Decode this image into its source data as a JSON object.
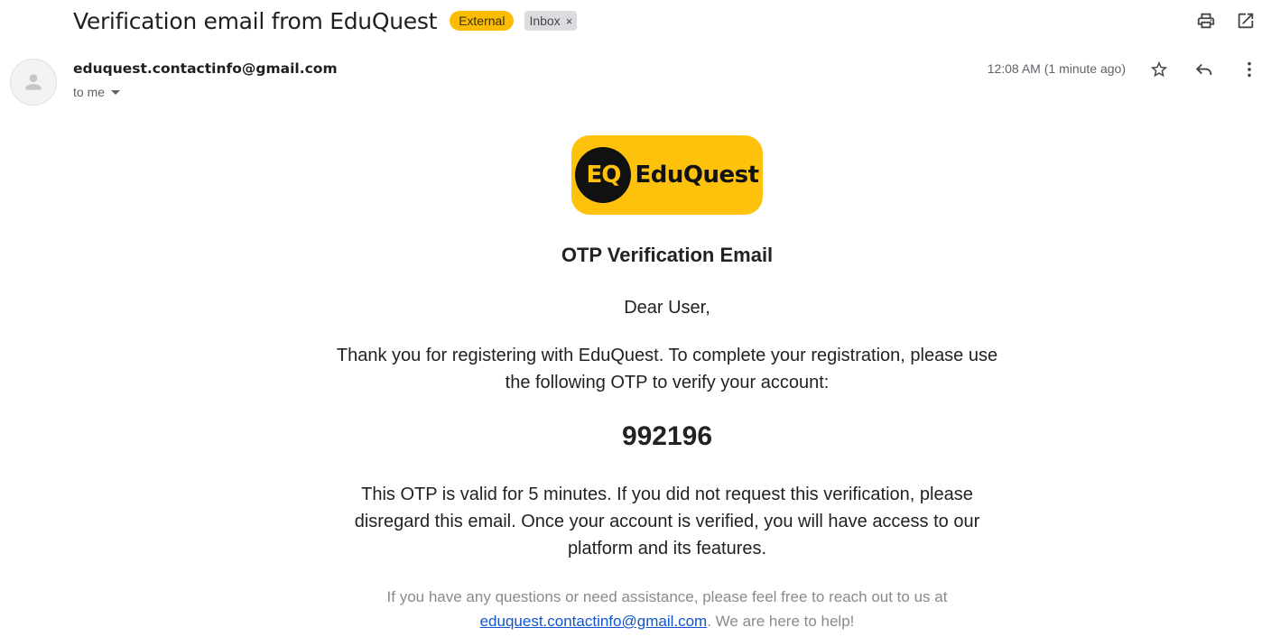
{
  "header": {
    "subject": "Verification email from EduQuest",
    "external_label": "External",
    "inbox_label": "Inbox",
    "inbox_remove": "×",
    "print_icon": "print-icon",
    "open_new_window_icon": "open-in-new-icon"
  },
  "message": {
    "sender": "eduquest.contactinfo@gmail.com",
    "recipient": "to me",
    "timestamp": "12:08 AM (1 minute ago)",
    "icons": [
      "avatar-icon",
      "star-icon",
      "reply-icon",
      "more-vert-icon"
    ]
  },
  "email": {
    "logo": {
      "monogram": "EQ",
      "name": "EduQuest",
      "color": "#fec20c"
    },
    "heading": "OTP Verification Email",
    "greeting": "Dear User,",
    "intro": "Thank you for registering with EduQuest. To complete your registration, please use the following OTP to verify your account:",
    "otp": "992196",
    "validity": "This OTP is valid for 5 minutes. If you did not request this verification, please disregard this email. Once your account is verified, you will have access to our platform and its features.",
    "footer_before": "If you have any questions or need assistance, please feel free to reach out to us at ",
    "footer_link": "eduquest.contactinfo@gmail.com",
    "footer_after": ". We are here to help!"
  },
  "colors": {
    "external_badge": "#fbbc04",
    "inbox_badge": "#dadce0",
    "link": "#1155cc"
  }
}
